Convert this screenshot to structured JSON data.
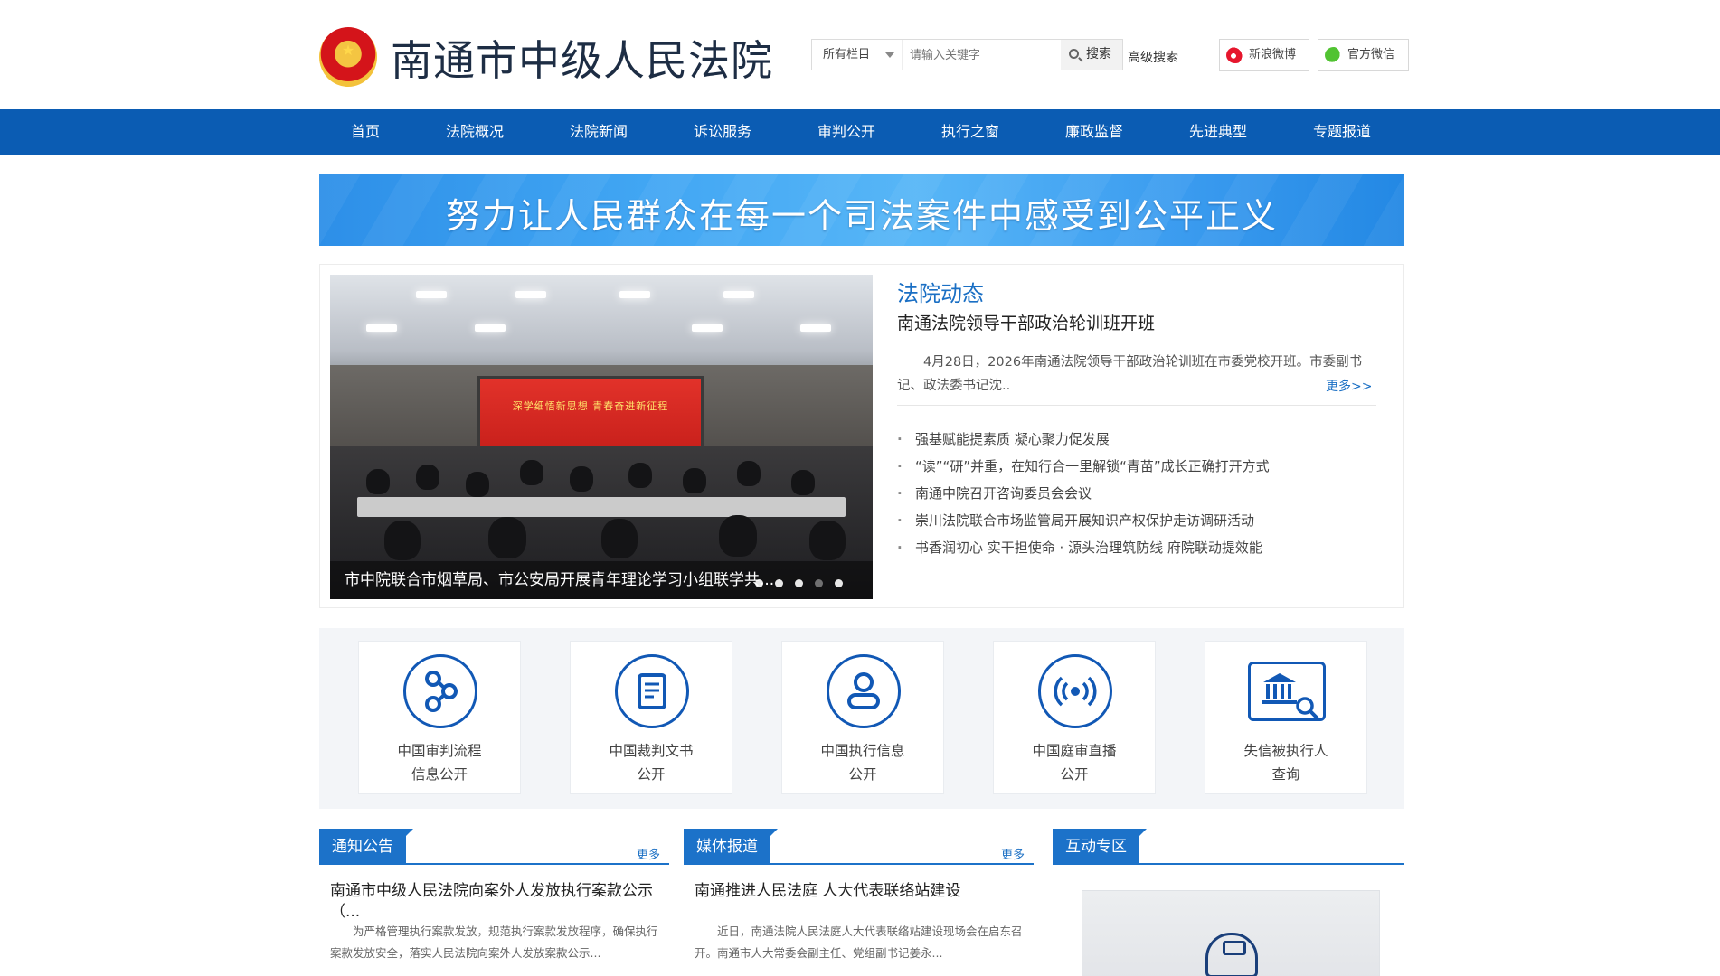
{
  "header": {
    "site_title": "南通市中级人民法院",
    "search": {
      "category": "所有栏目",
      "placeholder": "请输入关键字",
      "button": "搜索",
      "advanced": "高级搜索"
    },
    "social": {
      "weibo": "新浪微博",
      "wechat": "官方微信"
    }
  },
  "nav": {
    "items": [
      "首页",
      "法院概况",
      "法院新闻",
      "诉讼服务",
      "审判公开",
      "执行之窗",
      "廉政监督",
      "先进典型",
      "专题报道"
    ]
  },
  "banner": {
    "text": "努力让人民群众在每一个司法案件中感受到公平正义"
  },
  "news": {
    "slide": {
      "screen_text": "深学细悟新思想 青春奋进新征程",
      "caption": "市中院联合市烟草局、市公安局开展青年理论学习小组联学共...",
      "dot_count": 5,
      "active_dot": 4
    },
    "section_title": "法院动态",
    "headline": "南通法院领导干部政治轮训班开班",
    "summary": "4月28日，2026年南通法院领导干部政治轮训班在市委党校开班。市委副书记、政法委书记沈..",
    "more": "更多>>",
    "list": [
      "强基赋能提素质 凝心聚力促发展",
      "“读”“研”并重，在知行合一里解锁“青苗”成长正确打开方式",
      "南通中院召开咨询委员会会议",
      "崇川法院联合市场监管局开展知识产权保护走访调研活动",
      "书香润初心 实干担使命 ·  源头治理筑防线 府院联动提效能"
    ]
  },
  "services": [
    {
      "line1": "中国审判流程",
      "line2": "信息公开",
      "icon": "share-nodes-icon"
    },
    {
      "line1": "中国裁判文书",
      "line2": "公开",
      "icon": "document-icon"
    },
    {
      "line1": "中国执行信息",
      "line2": "公开",
      "icon": "person-icon"
    },
    {
      "line1": "中国庭审直播",
      "line2": "公开",
      "icon": "broadcast-icon"
    },
    {
      "line1": "失信被执行人",
      "line2": "查询",
      "icon": "court-search-icon"
    }
  ],
  "panels": {
    "notice": {
      "tab": "通知公告",
      "more": "更多",
      "title": "南通市中级人民法院向案外人发放执行案款公示（...",
      "text": "为严格管理执行案款发放，规范执行案款发放程序，确保执行案款发放安全，落实人民法院向案外人发放案款公示..."
    },
    "media": {
      "tab": "媒体报道",
      "more": "更多",
      "title": "南通推进人民法庭 人大代表联络站建设",
      "text": "近日，南通法院人民法庭人大代表联络站建设现场会在启东召开。南通市人大常委会副主任、党组副书记姜永..."
    },
    "interact": {
      "tab": "互动专区"
    }
  },
  "colors": {
    "nav_bg": "#0b5cb3",
    "accent": "#1c72c9",
    "icon_blue": "#1158b5"
  }
}
